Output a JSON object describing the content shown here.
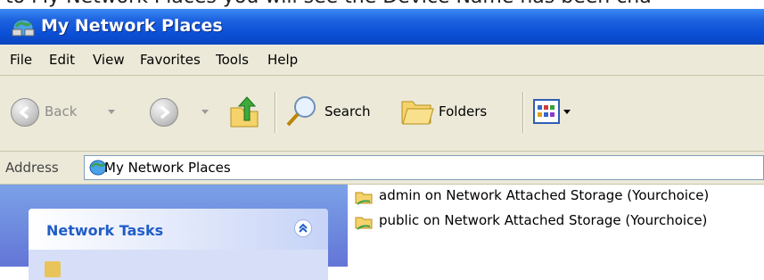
{
  "caption": "to My Network Places you will see the Device Name has been cha",
  "window": {
    "title": "My Network Places",
    "title_icon": "network-places-icon"
  },
  "menu": [
    {
      "label": "File"
    },
    {
      "label": "Edit"
    },
    {
      "label": "View"
    },
    {
      "label": "Favorites"
    },
    {
      "label": "Tools"
    },
    {
      "label": "Help"
    }
  ],
  "toolbar": {
    "back_label": "Back",
    "search_label": "Search",
    "folders_label": "Folders"
  },
  "address": {
    "label": "Address",
    "value": "My Network Places",
    "icon": "network-places-icon"
  },
  "tasks": {
    "title": "Network Tasks"
  },
  "items": [
    {
      "label": "admin on Network Attached Storage (Yourchoice)",
      "icon": "network-folder-icon"
    },
    {
      "label": "public on Network Attached Storage (Yourchoice)",
      "icon": "network-folder-icon"
    }
  ],
  "colors": {
    "titlebar": "#0a4fd6",
    "chrome": "#ece9d8",
    "task_title": "#215dc6",
    "left_pane": "#6f8ce0"
  }
}
